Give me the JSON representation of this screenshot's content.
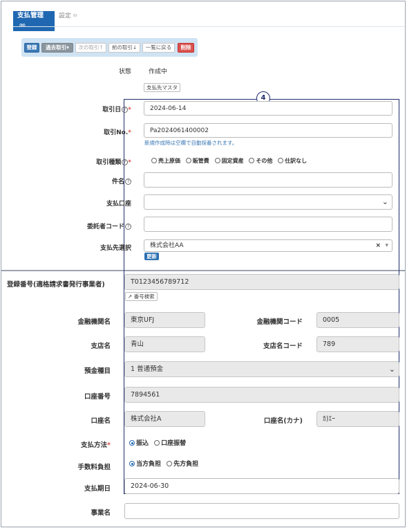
{
  "tabs": {
    "payment": {
      "label": "支払管理",
      "sub": "(H)"
    },
    "settings": {
      "label": "設定",
      "sub": "(I)"
    }
  },
  "toolbar": {
    "register": "登録",
    "past": "過去取引▾",
    "next": "次の取引↑",
    "prev": "前の取引↓",
    "back": "一覧に戻る",
    "delete": "削除"
  },
  "status": {
    "label": "状態",
    "value": "作成中"
  },
  "payee_master_button": "支払先マスタ",
  "badge": "4",
  "help_glyph": "?",
  "required_mark": "*",
  "form": {
    "date": {
      "label": "取引日",
      "value": "2024-06-14"
    },
    "txno": {
      "label": "取引No.",
      "value": "Pa2024061400002",
      "hint": "新規作成時は空欄で自動採番されます。"
    },
    "type": {
      "label": "取引種類",
      "options": [
        "売上原価",
        "販管費",
        "固定資産",
        "その他",
        "仕訳なし"
      ]
    },
    "subject": {
      "label": "件名",
      "value": ""
    },
    "account": {
      "label": "支払口座",
      "value": ""
    },
    "consignor": {
      "label": "委託者コード",
      "value": ""
    },
    "payee": {
      "label": "支払先選択",
      "value": "株式会社AA",
      "clear": "×",
      "arrow": "▾",
      "update_button": "更新"
    }
  },
  "payee_detail": {
    "reg_no": {
      "label": "登録番号(適格請求書発行事業者)",
      "value": "T0123456789712",
      "search_button": "番号検索"
    },
    "bank_name": {
      "label": "金融機関名",
      "value": "東京UFJ"
    },
    "bank_code": {
      "label": "金融機関コード",
      "value": "0005"
    },
    "branch_name": {
      "label": "支店名",
      "value": "青山"
    },
    "branch_code": {
      "label": "支店名コード",
      "value": "789"
    },
    "deposit_type": {
      "label": "預金種目",
      "value": "1 普通預金"
    },
    "account_no": {
      "label": "口座番号",
      "value": "7894561"
    },
    "account_name": {
      "label": "口座名",
      "value": "株式会社A"
    },
    "account_kana": {
      "label": "口座名(カナ)",
      "value": "ｶ)ｴｰ"
    },
    "method": {
      "label": "支払方法",
      "options": [
        "振込",
        "口座振替"
      ],
      "selected": 0
    },
    "fee": {
      "label": "手数料負担",
      "options": [
        "当方負担",
        "先方負担"
      ],
      "selected": 0
    },
    "due_date": {
      "label": "支払期日",
      "value": "2024-06-30"
    },
    "business_name": {
      "label": "事業名",
      "value": ""
    }
  },
  "colors": {
    "accent": "#1f67b1",
    "callout": "#1f2c6b",
    "danger": "#d9534f"
  }
}
